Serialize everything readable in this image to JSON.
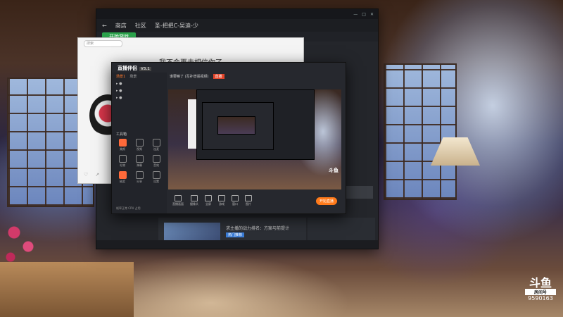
{
  "game_window": {
    "nav": [
      "商店",
      "社区"
    ],
    "title": "圣-把把C-吴迪-少",
    "start_button": "开始游戏",
    "feed_card_text": "求主播的战力排名：方案与前提计",
    "feed_card_tag": "热门推荐"
  },
  "chat_window": {
    "search_placeholder": "搜索",
    "title": "我不会再去相信你了"
  },
  "live_app": {
    "logo": "直播伴侣",
    "version": "V3.1",
    "stream_title": "谁要嘛了 (互补增强视频)",
    "live_badge": "直播",
    "tabs": [
      "场景1",
      "场景"
    ],
    "tools_title": "工具箱",
    "tools": [
      "美颜",
      "视频",
      "连麦",
      "礼物",
      "弹幕",
      "音效",
      "抽奖",
      "分享",
      "设置"
    ],
    "bottom_bar": [
      "直播画面",
      "摄像头",
      "全屏",
      "游戏",
      "窗口",
      "图片"
    ],
    "start_button": "开始直播",
    "footer_status": "帧率正常 CPU 占用"
  },
  "watermark": {
    "brand": "斗鱼",
    "sub": "房间号",
    "room": "9590163"
  }
}
